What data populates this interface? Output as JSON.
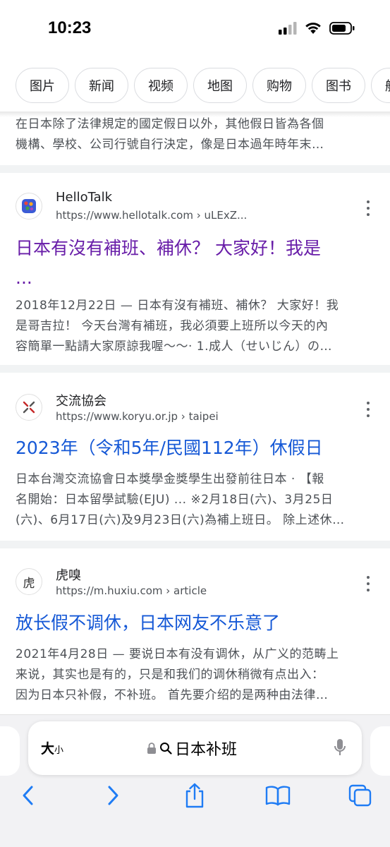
{
  "status_bar": {
    "time": "10:23"
  },
  "chips": [
    "图片",
    "新闻",
    "视频",
    "地图",
    "购物",
    "图书",
    "航班"
  ],
  "top_snippet": {
    "lines": [
      "在日本除了法律規定的國定假日以外，其他假日皆為各個",
      "機構、學校、公司行號自行決定，像是日本過年時年末…"
    ]
  },
  "results": [
    {
      "site": "HelloTalk",
      "url": "https://www.hellotalk.com › uLExZ...",
      "title_lines": [
        "日本有沒有補班、補休？ 大家好！我是",
        "..."
      ],
      "snippet_lines": [
        "2018年12月22日 — 日本有沒有補班、補休？ 大家好！我",
        "是哥吉拉！ 今天台灣有補班，我必須要上班所以今天的內",
        "容簡單一點請大家原諒我喔～～· 1.成人（せいじん）の…"
      ]
    },
    {
      "site": "交流協会",
      "url": "https://www.koryu.or.jp › taipei",
      "title_lines": [
        "2023年（令和5年/民國112年）休假日"
      ],
      "snippet_lines": [
        "日本台灣交流協會日本獎學金獎學生出發前往日本 · 【報",
        "名開始：日本留學試驗(EJU) ... ※2月18日(六)、3月25日",
        "(六)、6月17日(六)及9月23日(六)為補上班日。 除上述休…"
      ]
    },
    {
      "site": "虎嗅",
      "favicon_text": "虎",
      "url": "https://m.huxiu.com › article",
      "title_lines": [
        "放长假不调休，日本网友不乐意了"
      ],
      "snippet_lines": [
        "2021年4月28日 — 要说日本有没有调休，从广义的范畴上",
        "来说，其实也是有的，只是和我们的调休稍微有点出入：",
        "因为日本只补假，不补班。 首先要介绍的是两种由法律…"
      ]
    }
  ],
  "address_bar": {
    "aa_big": "大",
    "aa_small": "小",
    "query": "日本补班"
  },
  "colors": {
    "link": "#1558d6",
    "visited": "#681da8",
    "ios_blue": "#1f7cf4"
  }
}
